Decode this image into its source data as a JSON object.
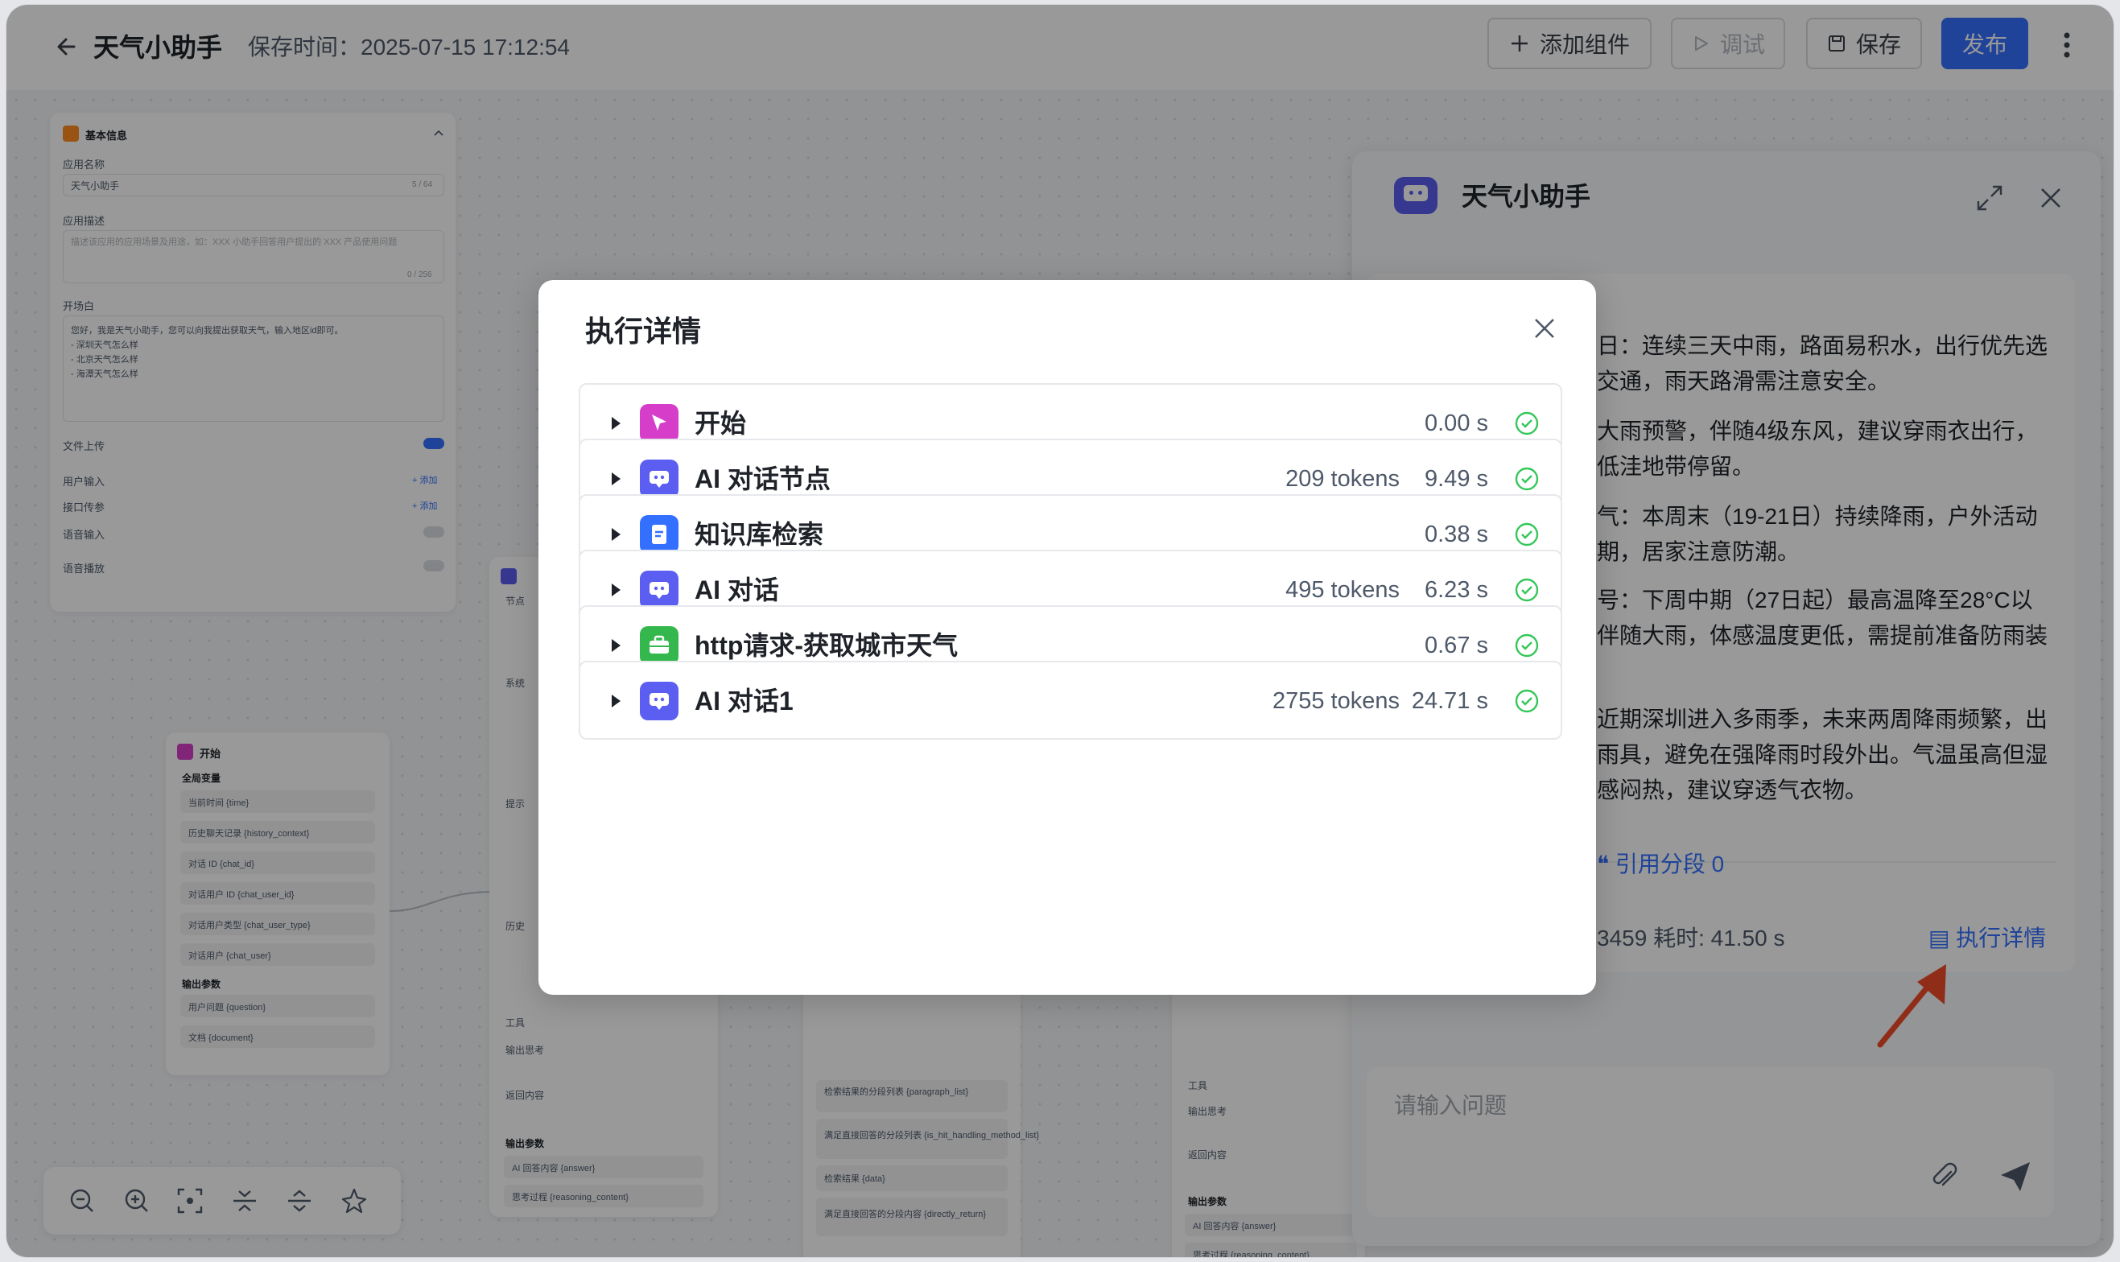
{
  "header": {
    "title": "天气小助手",
    "save_time": "保存时间：2025-07-15 17:12:54",
    "add_component": "添加组件",
    "debug": "调试",
    "save": "保存",
    "publish": "发布"
  },
  "basic_info": {
    "section_title": "基本信息",
    "app_name_label": "应用名称",
    "app_name_value": "天气小助手",
    "app_name_count": "5 / 64",
    "desc_label": "应用描述",
    "desc_placeholder": "描述该应用的应用场景及用途，如：XXX 小助手回答用户提出的 XXX 产品使用问题",
    "desc_count": "0 / 256",
    "opening_label": "开场白",
    "opening_lines": [
      "您好，我是天气小助手，您可以向我提出获取天气，输入地区id即可。",
      "- 深圳天气怎么样",
      "- 北京天气怎么样",
      "- 海潭天气怎么样"
    ],
    "file_upload": "文件上传",
    "user_input": "用户输入",
    "api_params": "接口传参",
    "voice_input": "语音输入",
    "voice_play": "语音播放",
    "add": "+ 添加"
  },
  "start_node": {
    "title": "开始",
    "global_vars": "全局变量",
    "vars": [
      "当前时间 {time}",
      "历史聊天记录 {history_context}",
      "对话 ID {chat_id}",
      "对话用户 ID {chat_user_id}",
      "对话用户类型 {chat_user_type}",
      "对话用户 {chat_user}"
    ],
    "output_params": "输出参数",
    "outputs": [
      "用户问题 {question}",
      "文档 {document}"
    ]
  },
  "bg_nodes": {
    "tool": "工具",
    "output_thinking": "输出思考",
    "return_content": "返回内容",
    "output_params": "输出参数",
    "ai_answer": "AI 回答内容 {answer}",
    "reasoning": "思考过程 {reasoning_content}",
    "kb_outputs": [
      "检索结果的分段列表 {paragraph_list}",
      "满足直接回答的分段列表 {is_hit_handling_method_list}",
      "检索结果 {data}",
      "满足直接回答的分段内容 {directly_return}"
    ],
    "frag_node": "节点",
    "frag_system": "系统",
    "frag_prompt": "提示",
    "frag_history": "历史"
  },
  "chat": {
    "title": "天气小助手",
    "lines": [
      "日：连续三天中雨，路面易积水，出行优先选",
      "交通，雨天路滑需注意安全。",
      "大雨预警，伴随4级东风，建议穿雨衣出行，",
      "低洼地带停留。",
      "气：本周末（19-21日）持续降雨，户外活动",
      "期，居家注意防潮。",
      "号：下周中期（27日起）最高温降至28°C以",
      "伴随大雨，体感温度更低，需提前准备防雨装",
      "",
      "近期深圳进入多雨季，未来两周降雨频繁，出",
      "雨具，避免在强降雨时段外出。气温虽高但湿",
      "感闷热，建议穿透气衣物。"
    ],
    "cite": "引用分段 0",
    "stats": "3459  耗时: 41.50 s",
    "exec_link": "执行详情",
    "input_placeholder": "请输入问题"
  },
  "modal": {
    "title": "执行详情",
    "rows": [
      {
        "name": "开始",
        "tokens": "",
        "time": "0.00 s",
        "icon": "start-cursor-icon",
        "color": "#d63ec9"
      },
      {
        "name": "AI 对话节点",
        "tokens": "209 tokens",
        "time": "9.49 s",
        "icon": "ai-chat-icon",
        "color": "#5b5ef0"
      },
      {
        "name": "知识库检索",
        "tokens": "",
        "time": "0.38 s",
        "icon": "knowledge-base-icon",
        "color": "#3370ff"
      },
      {
        "name": "AI 对话",
        "tokens": "495 tokens",
        "time": "6.23 s",
        "icon": "ai-chat-icon",
        "color": "#5b5ef0"
      },
      {
        "name": "http请求-获取城市天气",
        "tokens": "",
        "time": "0.67 s",
        "icon": "toolbox-icon",
        "color": "#34b84e"
      },
      {
        "name": "AI 对话1",
        "tokens": "2755 tokens",
        "time": "24.71 s",
        "icon": "ai-chat-icon",
        "color": "#5b5ef0"
      }
    ]
  },
  "colors": {
    "primary": "#3370ff",
    "success": "#34c759",
    "arrow": "#f04b2a"
  }
}
